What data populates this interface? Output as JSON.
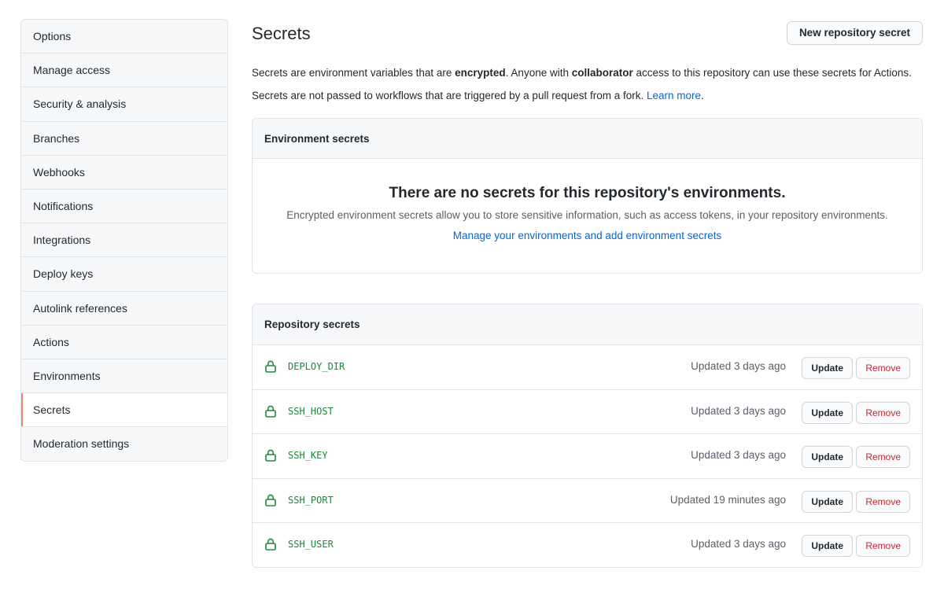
{
  "sidebar": {
    "items": [
      {
        "label": "Options"
      },
      {
        "label": "Manage access"
      },
      {
        "label": "Security & analysis"
      },
      {
        "label": "Branches"
      },
      {
        "label": "Webhooks"
      },
      {
        "label": "Notifications"
      },
      {
        "label": "Integrations"
      },
      {
        "label": "Deploy keys"
      },
      {
        "label": "Autolink references"
      },
      {
        "label": "Actions"
      },
      {
        "label": "Environments"
      },
      {
        "label": "Secrets",
        "selected": true
      },
      {
        "label": "Moderation settings"
      }
    ]
  },
  "header": {
    "title": "Secrets",
    "new_button_label": "New repository secret"
  },
  "description": {
    "line1_part1": "Secrets are environment variables that are ",
    "line1_bold1": "encrypted",
    "line1_part2": ". Anyone with ",
    "line1_bold2": "collaborator",
    "line1_part3": " access to this repository can use these secrets for Actions.",
    "line2_text": "Secrets are not passed to workflows that are triggered by a pull request from a fork. ",
    "line2_link": "Learn more",
    "line2_end": "."
  },
  "environment_secrets": {
    "header": "Environment secrets",
    "empty_title": "There are no secrets for this repository's environments.",
    "empty_text": "Encrypted environment secrets allow you to store sensitive information, such as access tokens, in your repository environments.",
    "manage_link": "Manage your environments and add environment secrets"
  },
  "repository_secrets": {
    "header": "Repository secrets",
    "update_label": "Update",
    "remove_label": "Remove",
    "rows": [
      {
        "name": "DEPLOY_DIR",
        "updated": "Updated 3 days ago"
      },
      {
        "name": "SSH_HOST",
        "updated": "Updated 3 days ago"
      },
      {
        "name": "SSH_KEY",
        "updated": "Updated 3 days ago"
      },
      {
        "name": "SSH_PORT",
        "updated": "Updated 19 minutes ago"
      },
      {
        "name": "SSH_USER",
        "updated": "Updated 3 days ago"
      }
    ]
  },
  "colors": {
    "accent_selected": "#f9826c",
    "link": "#0366d6",
    "secret_name": "#22863a",
    "danger": "#cb2431"
  },
  "icons": {
    "secret_row": "lock-icon"
  }
}
